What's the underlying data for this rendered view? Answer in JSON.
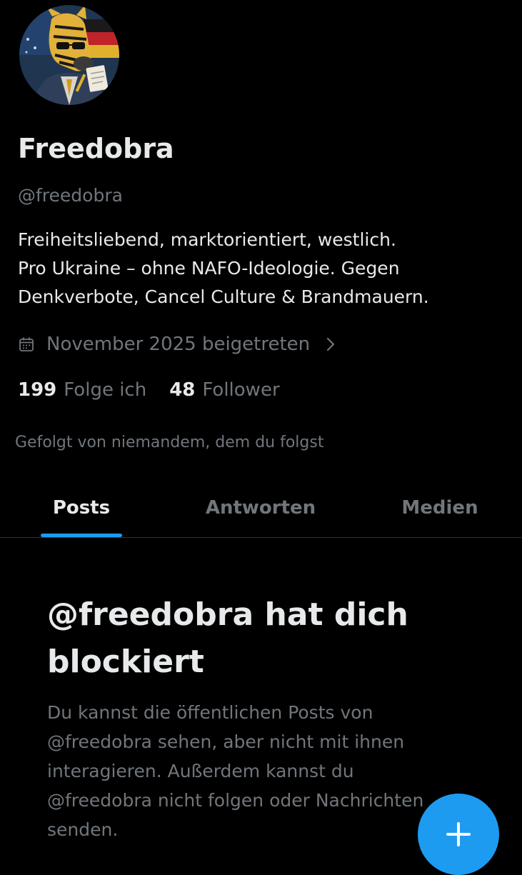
{
  "profile": {
    "display_name": "Freedobra",
    "handle": "@freedobra",
    "bio_lines": [
      "Freiheitsliebend, marktorientiert, westlich.",
      "Pro Ukraine – ohne NAFO-Ideologie. Gegen",
      "Denkverbote, Cancel Culture & Brandmauern."
    ],
    "joined": "November 2025 beigetreten",
    "following_count": "199",
    "following_label": "Folge ich",
    "followers_count": "48",
    "followers_label": "Follower",
    "followed_by": "Gefolgt von niemandem, dem du folgst"
  },
  "tabs": [
    {
      "label": "Posts",
      "active": true
    },
    {
      "label": "Antworten",
      "active": false
    },
    {
      "label": "Medien",
      "active": false
    }
  ],
  "blocked": {
    "title_lines": [
      "@freedobra hat dich",
      "blockiert"
    ],
    "text_lines": [
      "Du kannst die öffentlichen Posts von",
      "@freedobra sehen, aber nicht mit ihnen",
      "interagieren. Außerdem kannst du",
      "@freedobra nicht folgen oder Nachrichten",
      "senden."
    ]
  },
  "icons": {
    "avatar": "zebra-avatar",
    "joined": "calendar-icon",
    "joined_more": "chevron-right-icon",
    "fab": "plus-icon"
  },
  "colors": {
    "background": "#000000",
    "text_primary": "#e7e9ea",
    "text_secondary": "#71767b",
    "accent": "#1d9bf0",
    "divider": "#2f3336"
  }
}
